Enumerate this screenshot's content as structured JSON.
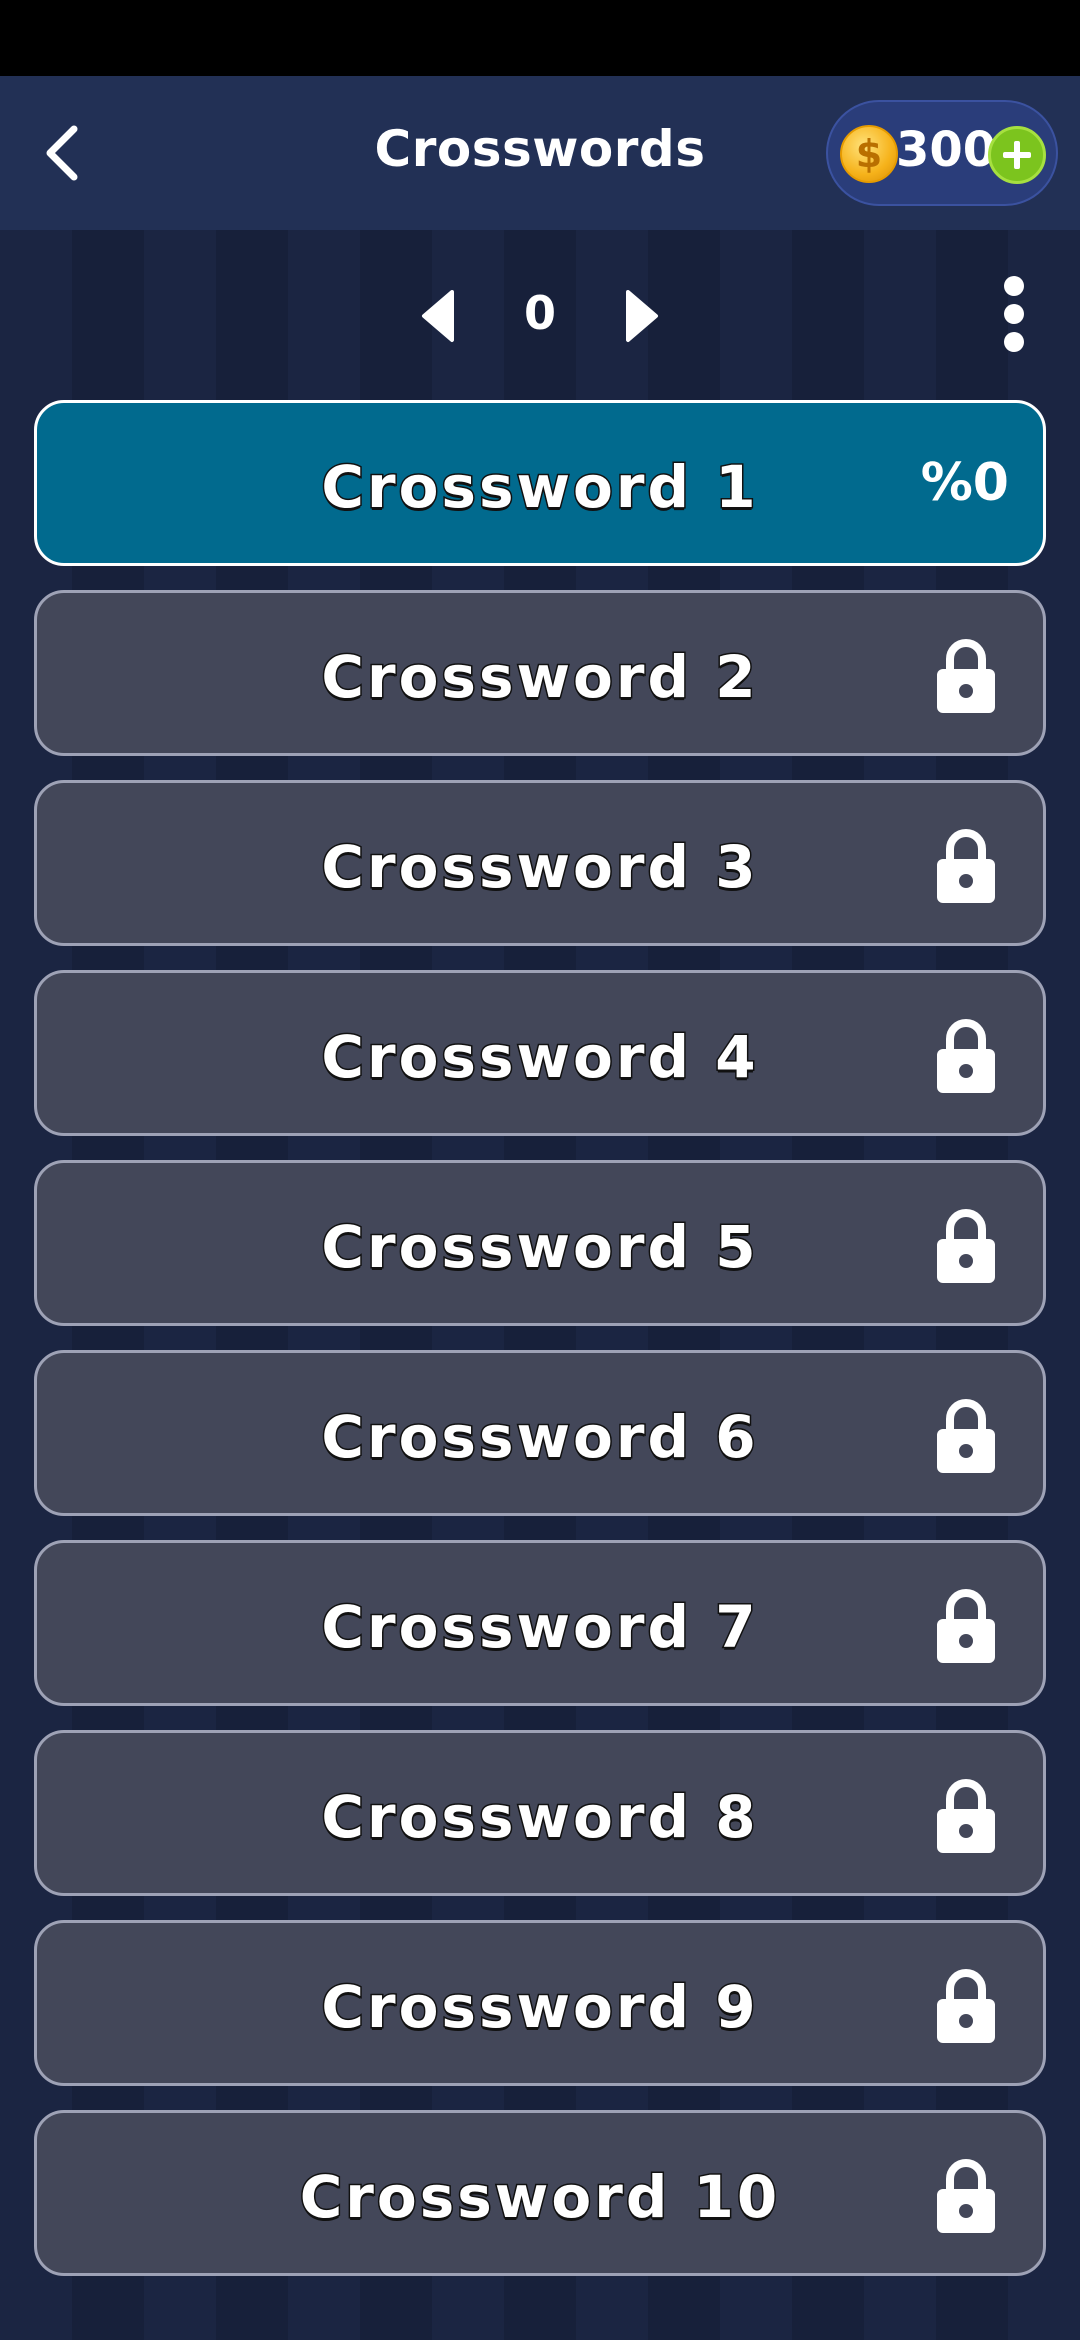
{
  "header": {
    "title": "Crosswords",
    "coins": "300"
  },
  "pager": {
    "value": "0"
  },
  "puzzles": [
    {
      "label": "Crossword 1",
      "status": "%0",
      "locked": false
    },
    {
      "label": "Crossword 2",
      "locked": true
    },
    {
      "label": "Crossword 3",
      "locked": true
    },
    {
      "label": "Crossword 4",
      "locked": true
    },
    {
      "label": "Crossword 5",
      "locked": true
    },
    {
      "label": "Crossword 6",
      "locked": true
    },
    {
      "label": "Crossword 7",
      "locked": true
    },
    {
      "label": "Crossword 8",
      "locked": true
    },
    {
      "label": "Crossword 9",
      "locked": true
    },
    {
      "label": "Crossword 10",
      "locked": true
    }
  ],
  "icons": {
    "back": "chevron-left-icon",
    "coin": "coin-icon",
    "add": "plus-icon",
    "prev": "triangle-left-icon",
    "next": "triangle-right-icon",
    "more": "vertical-dots-icon",
    "lock": "lock-icon"
  },
  "colors": {
    "active_item": "#016a8e",
    "locked_item": "#434759",
    "header": "#223055",
    "coin": "#f6b21a",
    "add_button": "#7cc41e"
  }
}
